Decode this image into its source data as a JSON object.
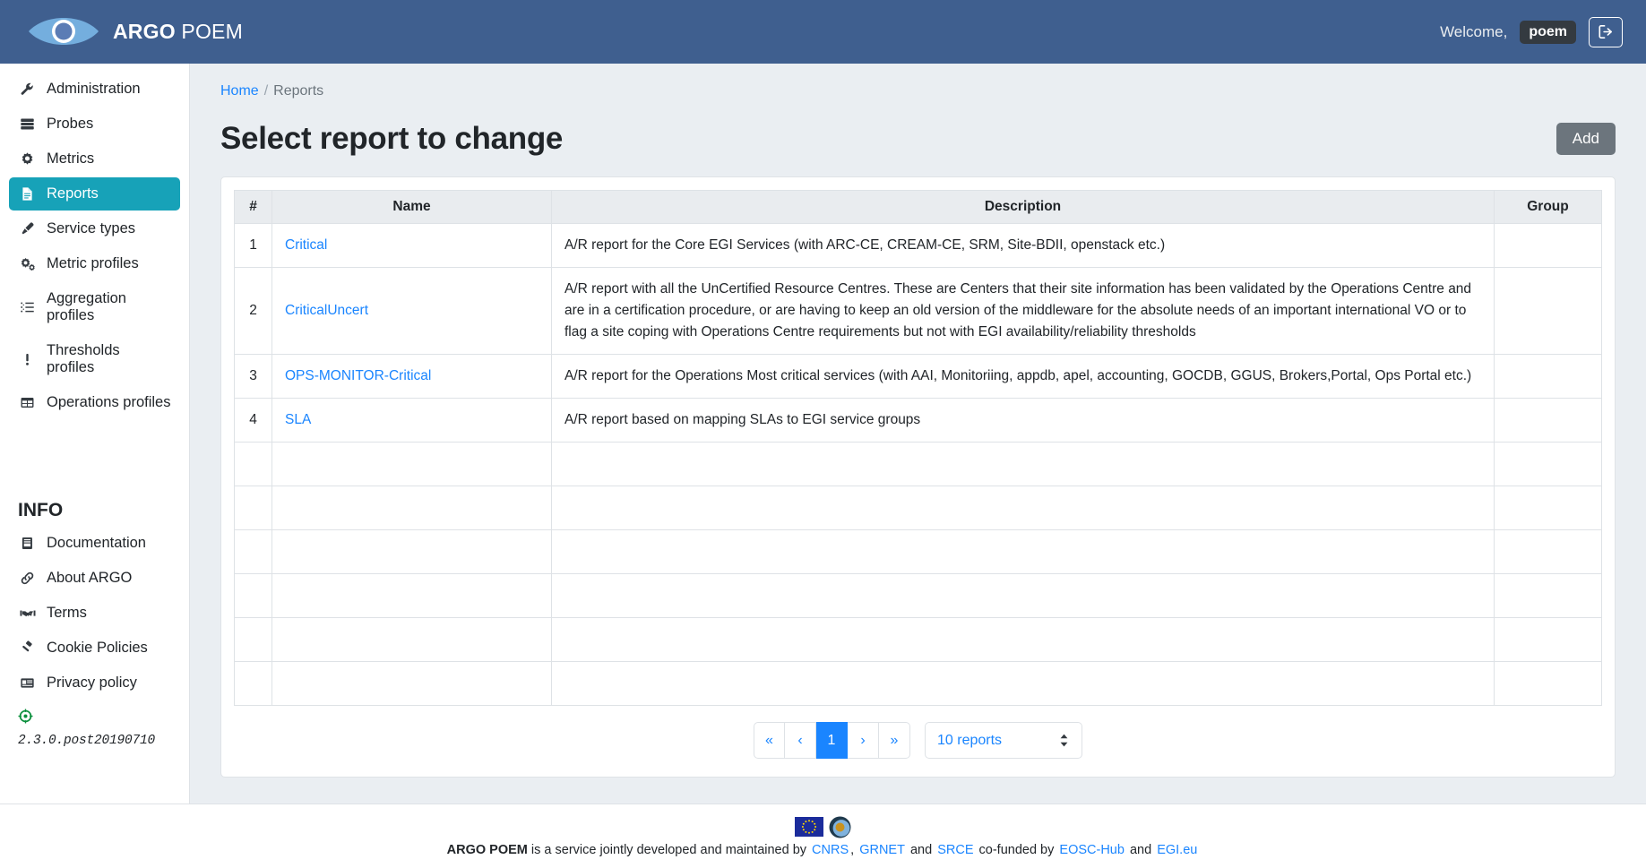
{
  "header": {
    "brand_strong": "ARGO",
    "brand_light": "POEM",
    "welcome_label": "Welcome,",
    "username": "poem",
    "logout_icon": "sign-out-icon",
    "bg_color": "#3f5f8f"
  },
  "sidebar": {
    "items": [
      {
        "label": "Administration",
        "icon": "wrench-icon",
        "active": false
      },
      {
        "label": "Probes",
        "icon": "server-icon",
        "active": false
      },
      {
        "label": "Metrics",
        "icon": "gear-icon",
        "active": false
      },
      {
        "label": "Reports",
        "icon": "file-icon",
        "active": true
      },
      {
        "label": "Service types",
        "icon": "highlighter-icon",
        "active": false
      },
      {
        "label": "Metric profiles",
        "icon": "cogs-icon",
        "active": false
      },
      {
        "label": "Aggregation profiles",
        "icon": "list-ol-icon",
        "active": false
      },
      {
        "label": "Thresholds profiles",
        "icon": "exclamation-icon",
        "active": false
      },
      {
        "label": "Operations profiles",
        "icon": "table-icon",
        "active": false
      }
    ],
    "info_heading": "INFO",
    "info_items": [
      {
        "label": "Documentation",
        "icon": "book-icon"
      },
      {
        "label": "About ARGO",
        "icon": "link-icon"
      },
      {
        "label": "Terms",
        "icon": "handshake-icon"
      },
      {
        "label": "Cookie Policies",
        "icon": "gavel-icon"
      },
      {
        "label": "Privacy policy",
        "icon": "id-card-icon"
      }
    ],
    "version_icon": "crosshair-icon",
    "version_color": "#0a8f3c",
    "version": "2.3.0.post20190710",
    "active_color": "#17a2b8"
  },
  "main": {
    "breadcrumb": {
      "home": "Home",
      "separator": "/",
      "current": "Reports"
    },
    "page_title": "Select report to change",
    "add_button": "Add",
    "table": {
      "columns": [
        "#",
        "Name",
        "Description",
        "Group"
      ],
      "rows": [
        {
          "num": "1",
          "name": "Critical",
          "description": "A/R report for the Core EGI Services (with ARC-CE, CREAM-CE, SRM, Site-BDII, openstack etc.)",
          "group": ""
        },
        {
          "num": "2",
          "name": "CriticalUncert",
          "description": "A/R report with all the UnCertified Resource Centres. These are Centers that their site information has been validated by the Operations Centre and are in a certification procedure, or are having to keep an old version of the middleware for the absolute needs of an important international VO or to flag a site coping with Operations Centre requirements but not with EGI availability/reliability thresholds",
          "group": ""
        },
        {
          "num": "3",
          "name": "OPS-MONITOR-Critical",
          "description": "A/R report for the Operations Most critical services (with AAI, Monitoriing, appdb, apel, accounting, GOCDB, GGUS, Brokers,Portal, Ops Portal etc.)",
          "group": ""
        },
        {
          "num": "4",
          "name": "SLA",
          "description": "A/R report based on mapping SLAs to EGI service groups",
          "group": ""
        }
      ],
      "empty_row_count": 6
    },
    "pagination": {
      "first": "«",
      "prev": "‹",
      "pages": [
        "1"
      ],
      "active_page": "1",
      "next": "›",
      "last": "»",
      "page_size_label": "10 reports",
      "active_color": "#1a85ff"
    }
  },
  "footer": {
    "eu_flag_icon": "eu-flag-icon",
    "argo_logo_icon": "argo-logo-icon",
    "brand": "ARGO POEM",
    "text_1": " is a service jointly developed and maintained by ",
    "link_cnrs": "CNRS",
    "text_2": ", ",
    "link_grnet": "GRNET",
    "text_3": " and ",
    "link_srce": "SRCE",
    "text_4": " co-funded by ",
    "link_eosc": "EOSC-Hub",
    "text_5": " and ",
    "link_egi": "EGI.eu"
  }
}
